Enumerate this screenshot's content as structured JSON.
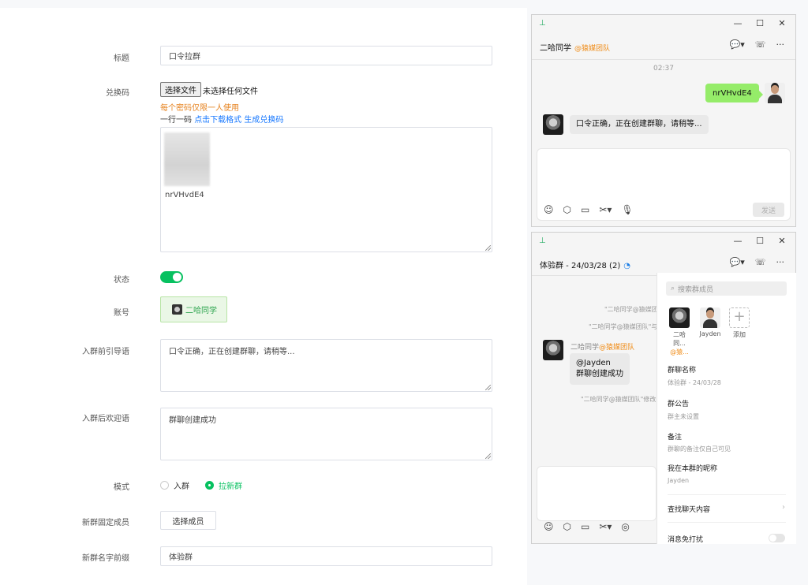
{
  "form": {
    "title_label": "标题",
    "title_value": "口令拉群",
    "code_label": "兑换码",
    "file_button": "选择文件",
    "file_status": "未选择任何文件",
    "warning": "每个密码仅限一人使用",
    "format_prefix": "一行一码",
    "download_link": "点击下载格式",
    "generate_link": "生成兑换码",
    "code_value": "nrVHvdE4",
    "status_label": "状态",
    "status_on": true,
    "account_label": "账号",
    "account_name": "二哈同学",
    "guide_label": "入群前引导语",
    "guide_value": "口令正确，正在创建群聊，请稍等...",
    "welcome_label": "入群后欢迎语",
    "welcome_value": "群聊创建成功",
    "mode_label": "模式",
    "mode_options": [
      "入群",
      "拉新群"
    ],
    "mode_selected": "拉新群",
    "fixed_members_label": "新群固定成员",
    "select_members_button": "选择成员",
    "prefix_label": "新群名字前缀",
    "prefix_value": "体验群"
  },
  "chat1": {
    "name": "二哈同学",
    "tag": "@猿媒团队",
    "time": "02:37",
    "my_message": "nrVHvdE4",
    "reply": "口令正确，正在创建群聊，请稍等...",
    "send_label": "发送"
  },
  "chat2": {
    "name": "体验群 - 24/03/28 (2)",
    "sys1": "\"二哈同学@猿媒团队\"邀",
    "sys2": "\"二哈同学@猿媒团队\"与",
    "sender": "二哈同学",
    "sender_tag": "@猿媒团队",
    "msg_line1": "@Jayden",
    "msg_line2": "群聊创建成功",
    "sys3": "\"二哈同学@猿媒团队\"修改"
  },
  "panel": {
    "search_placeholder": "搜索群成员",
    "members": [
      {
        "name": "二哈同...",
        "sub": "@猿..."
      },
      {
        "name": "Jayden",
        "sub": ""
      }
    ],
    "add_label": "添加",
    "group_name_label": "群聊名称",
    "group_name_value": "体验群 - 24/03/28",
    "notice_label": "群公告",
    "notice_value": "群主未设置",
    "remark_label": "备注",
    "remark_value": "群聊的备注仅自己可见",
    "nickname_label": "我在本群的昵称",
    "nickname_value": "Jayden",
    "find_label": "查找聊天内容",
    "mute_label": "消息免打扰"
  },
  "colors": {
    "accent_green": "#07c160",
    "bubble_green": "#95ec69",
    "warning_orange": "#e6821e",
    "link_blue": "#1677ff"
  }
}
